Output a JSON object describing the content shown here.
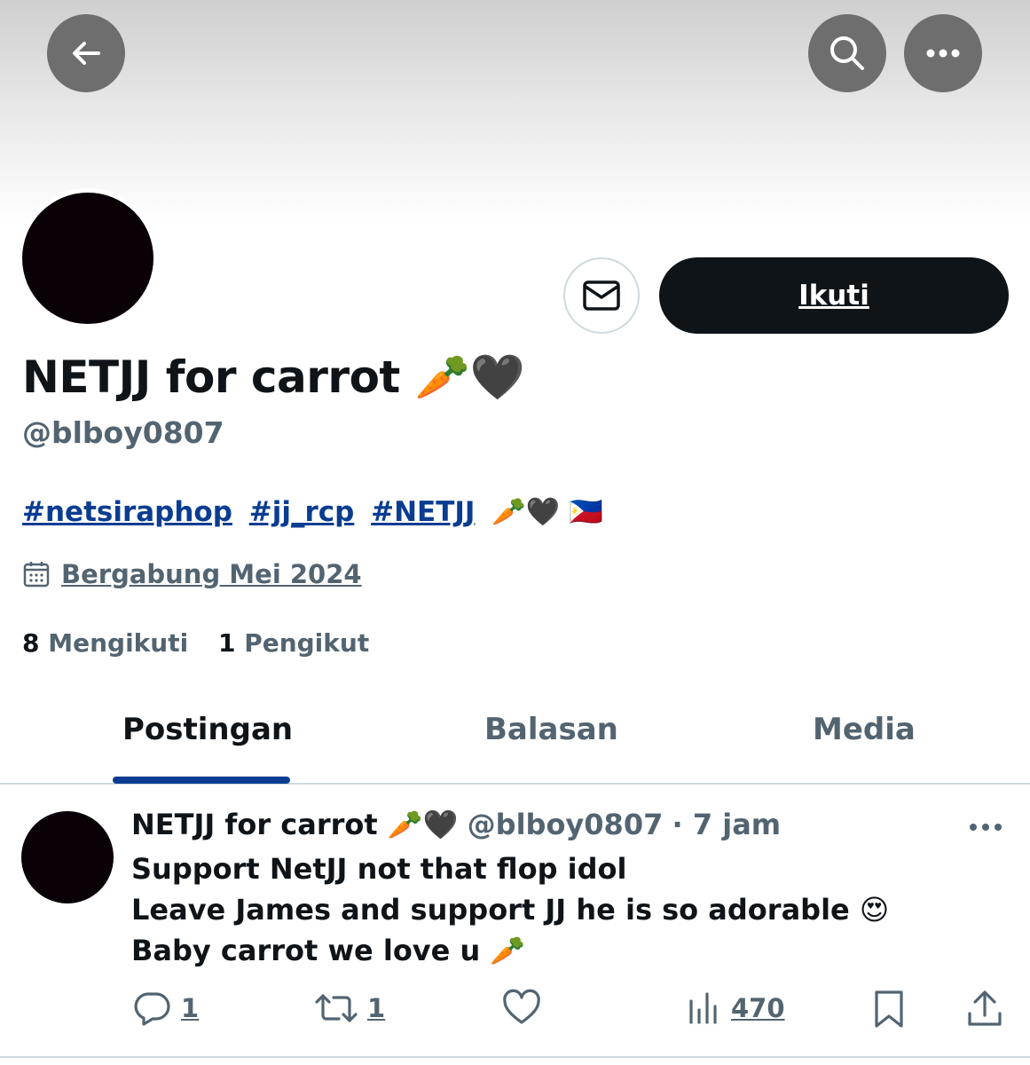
{
  "header": {
    "back_icon": "arrow-left-icon",
    "search_icon": "search-icon",
    "more_icon": "more-horizontal-icon"
  },
  "profile": {
    "display_name": "NETJJ for carrot 🥕🖤",
    "handle": "@blboy0807",
    "bio_hashtags": [
      "#netsiraphop",
      "#jj_rcp",
      "#NETJJ"
    ],
    "bio_emoji": "🥕🖤 🇵🇭",
    "joined": "Bergabung Mei 2024",
    "following_count": "8",
    "following_label": "Mengikuti",
    "followers_count": "1",
    "followers_label": "Pengikut",
    "follow_label": "Ikuti",
    "message_icon": "mail-icon"
  },
  "tabs": [
    {
      "label": "Postingan",
      "active": true
    },
    {
      "label": "Balasan",
      "active": false
    },
    {
      "label": "Media",
      "active": false
    }
  ],
  "tweet": {
    "name": "NETJJ for carrot 🥕🖤",
    "handle": "@blboy0807",
    "time": "· 7 jam",
    "lines": [
      "Support NetJJ not that flop idol",
      "Leave James and support JJ he is so adorable 😍",
      "Baby carrot we love u 🥕"
    ],
    "replies": "1",
    "reposts": "1",
    "views": "470"
  },
  "colors": {
    "accent": "#0a3d91",
    "text": "#0f1419",
    "muted": "#536471",
    "button_bg": "#0f1419"
  }
}
